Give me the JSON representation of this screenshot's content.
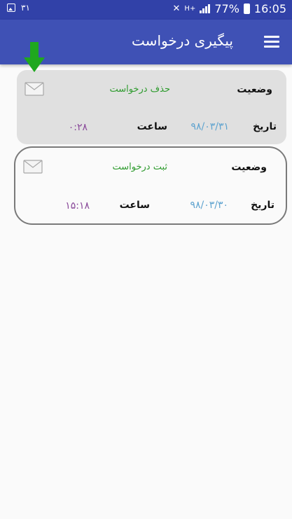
{
  "status_bar": {
    "left_count": "۳۱",
    "battery_percent": "77%",
    "time": "16:05",
    "network_type": "H+",
    "icons": [
      "gallery-icon",
      "mute-icon",
      "signal-icon",
      "battery-icon"
    ]
  },
  "app_bar": {
    "title": "پیگیری درخواست",
    "menu_icon": "hamburger-menu-icon"
  },
  "requests": [
    {
      "status_label": "وضعیت",
      "status_value": "حذف درخواست",
      "date_label": "تاریخ",
      "date_value": "۹۸/۰۳/۳۱",
      "time_label": "ساعت",
      "time_value": "۰:۲۸",
      "icon": "mail-icon"
    },
    {
      "status_label": "وضعیت",
      "status_value": "ثبت درخواست",
      "date_label": "تاریخ",
      "date_value": "۹۸/۰۳/۳۰",
      "time_label": "ساعت",
      "time_value": "۱۵:۱۸",
      "icon": "mail-icon"
    }
  ],
  "colors": {
    "app_bar": "#3f51b5",
    "status_bar": "#3141a8",
    "status_value": "#2e9b2e",
    "date_value": "#5ea3cf",
    "time_value": "#8a4a9a",
    "arrow": "#1fa81f"
  }
}
